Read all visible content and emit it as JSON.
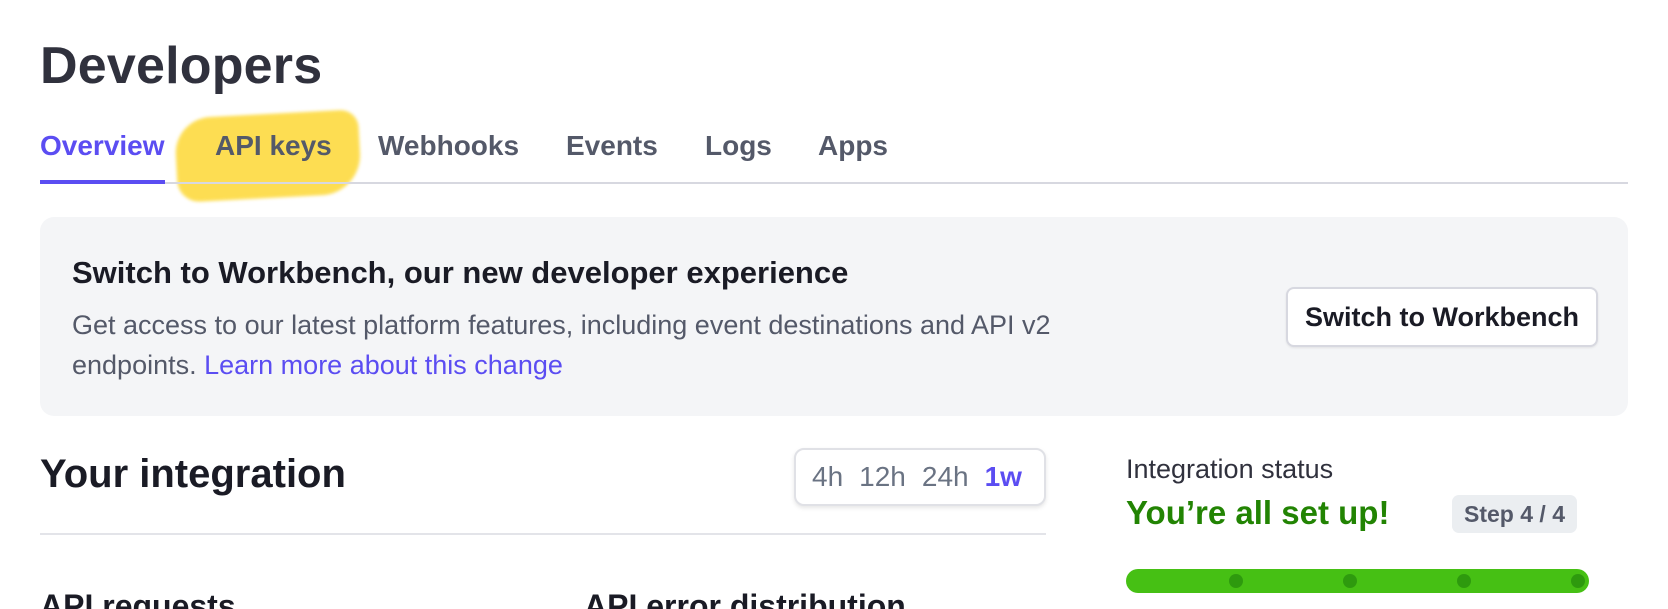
{
  "header": {
    "title": "Developers"
  },
  "tabs": [
    {
      "label": "Overview",
      "active": true
    },
    {
      "label": "API keys",
      "active": false
    },
    {
      "label": "Webhooks",
      "active": false
    },
    {
      "label": "Events",
      "active": false
    },
    {
      "label": "Logs",
      "active": false
    },
    {
      "label": "Apps",
      "active": false
    }
  ],
  "banner": {
    "title": "Switch to Workbench, our new developer experience",
    "description": "Get access to our latest platform features, including event destinations and API v2 endpoints.",
    "link": "Learn more about this change",
    "button": "Switch to Workbench"
  },
  "integration": {
    "title": "Your integration",
    "time_ranges": [
      "4h",
      "12h",
      "24h",
      "1w"
    ],
    "selected_range": "1w",
    "api_requests_heading": "API requests",
    "api_errors_heading": "API error distribution"
  },
  "status": {
    "label": "Integration status",
    "value": "You’re all set up!",
    "step": "Step 4 / 4",
    "progress_fraction": 1.0,
    "steps_total": 4
  },
  "colors": {
    "accent": "#5b4df2",
    "success": "#228403",
    "progress": "#46c014",
    "highlight": "#fdd835"
  }
}
